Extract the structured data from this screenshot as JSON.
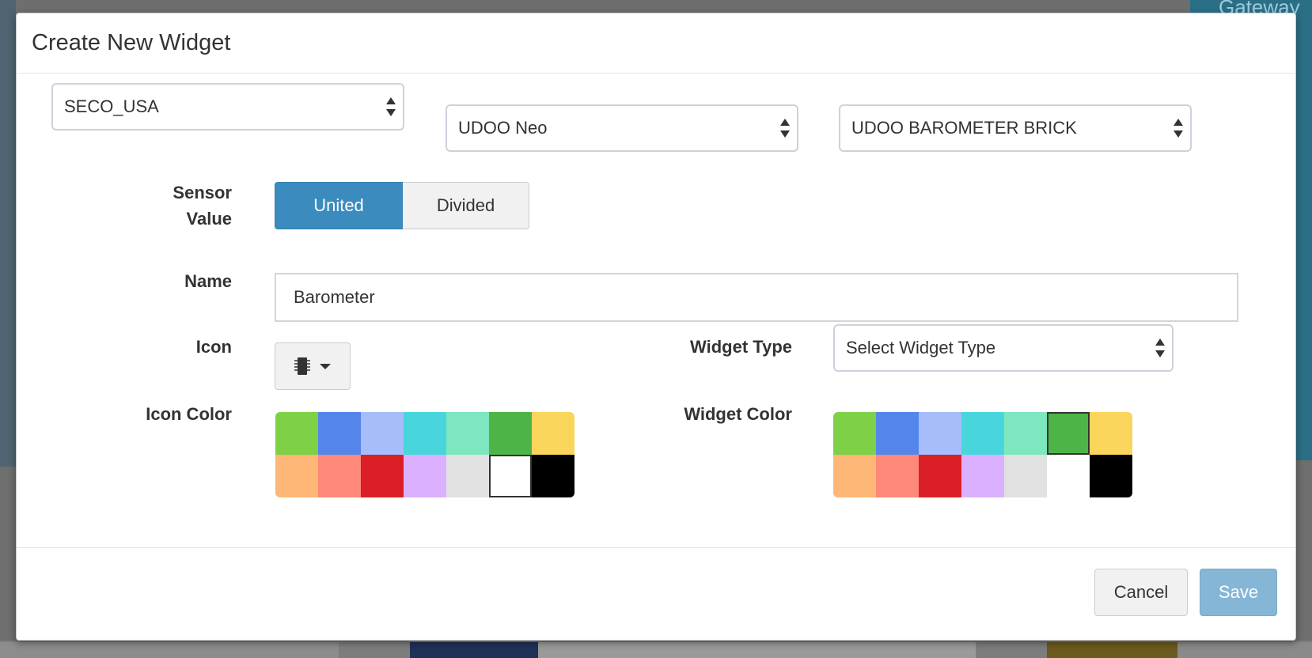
{
  "backdrop": {
    "gateway_label": "Gateway"
  },
  "dialog": {
    "title": "Create New Widget",
    "selects": {
      "organization": "SECO_USA",
      "device": "UDOO Neo",
      "sensor": "UDOO BAROMETER BRICK"
    },
    "sensor_value": {
      "label_line1": "Sensor",
      "label_line2": "Value",
      "options": [
        "United",
        "Divided"
      ],
      "selected": "United"
    },
    "name": {
      "label": "Name",
      "value": "Barometer"
    },
    "icon": {
      "label": "Icon",
      "selected_icon": "chip-icon"
    },
    "widget_type": {
      "label": "Widget Type",
      "placeholder": "Select Widget Type"
    },
    "icon_color": {
      "label": "Icon Color",
      "colors": [
        "#7ed147",
        "#5485ea",
        "#a6bcfb",
        "#48d6dc",
        "#7de7c0",
        "#4fb448",
        "#f9d55c",
        "#ffb777",
        "#fe8979",
        "#da1f26",
        "#dbb0fe",
        "#e1e1e1",
        "#ffffff",
        "#000000"
      ],
      "selected_index": 12
    },
    "widget_color": {
      "label": "Widget Color",
      "colors": [
        "#7ed147",
        "#5485ea",
        "#a6bcfb",
        "#48d6dc",
        "#7de7c0",
        "#4fb448",
        "#f9d55c",
        "#ffb777",
        "#fe8979",
        "#da1f26",
        "#dbb0fe",
        "#e1e1e1",
        "#ffffff",
        "#000000"
      ],
      "selected_index": 5
    },
    "buttons": {
      "cancel": "Cancel",
      "save": "Save"
    }
  }
}
